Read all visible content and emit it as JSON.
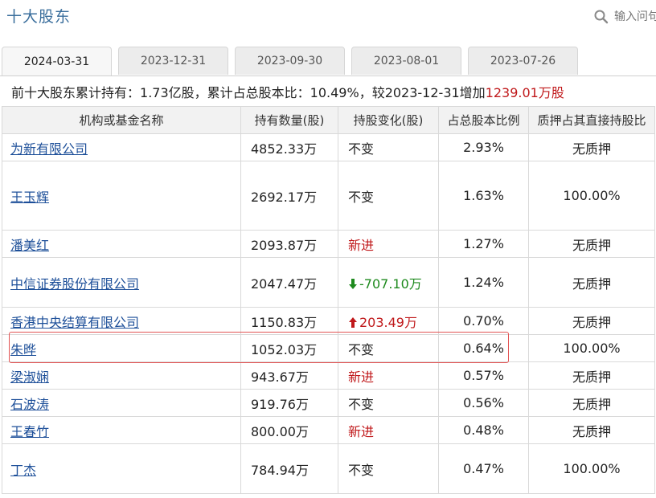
{
  "page_title": "十大股东",
  "search": {
    "placeholder": "输入问句"
  },
  "tabs": [
    {
      "label": "2024-03-31",
      "active": true
    },
    {
      "label": "2023-12-31",
      "active": false
    },
    {
      "label": "2023-09-30",
      "active": false
    },
    {
      "label": "2023-08-01",
      "active": false
    },
    {
      "label": "2023-07-26",
      "active": false
    }
  ],
  "summary": {
    "prefix": "前十大股东累计持有：",
    "total_shares": "1.73亿股",
    "ratio_label": "，累计占总股本比：",
    "ratio": "10.49%",
    "compare_label": "，较2023-12-31增加",
    "increase": "1239.01万股",
    "colors": {
      "increase": "#c0191b"
    }
  },
  "table": {
    "headers": [
      "机构或基金名称",
      "持有数量(股)",
      "持股变化(股)",
      "占总股本比例",
      "质押占其直接持股比"
    ],
    "rows": [
      {
        "name": "为新有限公司",
        "holding": "4852.33万",
        "change": "不变",
        "change_type": "same",
        "pct": "2.93%",
        "pledge": "无质押"
      },
      {
        "name": "王玉辉",
        "holding": "2692.17万",
        "change": "不变",
        "change_type": "same",
        "pct": "1.63%",
        "pledge": "100.00%"
      },
      {
        "name": "潘美红",
        "holding": "2093.87万",
        "change": "新进",
        "change_type": "new",
        "pct": "1.27%",
        "pledge": "无质押"
      },
      {
        "name": "中信证券股份有限公司",
        "holding": "2047.47万",
        "change": "-707.10万",
        "change_type": "down",
        "pct": "1.24%",
        "pledge": "无质押"
      },
      {
        "name": "香港中央结算有限公司",
        "holding": "1150.83万",
        "change": "203.49万",
        "change_type": "up",
        "pct": "0.70%",
        "pledge": "无质押"
      },
      {
        "name": "朱晔",
        "holding": "1052.03万",
        "change": "不变",
        "change_type": "same",
        "pct": "0.64%",
        "pledge": "100.00%",
        "highlighted": true
      },
      {
        "name": "梁淑娴",
        "holding": "943.67万",
        "change": "新进",
        "change_type": "new",
        "pct": "0.57%",
        "pledge": "无质押"
      },
      {
        "name": "石波涛",
        "holding": "919.76万",
        "change": "不变",
        "change_type": "same",
        "pct": "0.56%",
        "pledge": "无质押"
      },
      {
        "name": "王春竹",
        "holding": "800.00万",
        "change": "新进",
        "change_type": "new",
        "pct": "0.48%",
        "pledge": "无质押"
      },
      {
        "name": "丁杰",
        "holding": "784.94万",
        "change": "不变",
        "change_type": "same",
        "pct": "0.47%",
        "pledge": "100.00%"
      }
    ]
  },
  "colors": {
    "link": "#1d4f99",
    "title": "#3a6e9c",
    "new": "#c0191b",
    "up": "#c0191b",
    "down": "#1e8a1e",
    "highlight_border": "#e25454"
  }
}
